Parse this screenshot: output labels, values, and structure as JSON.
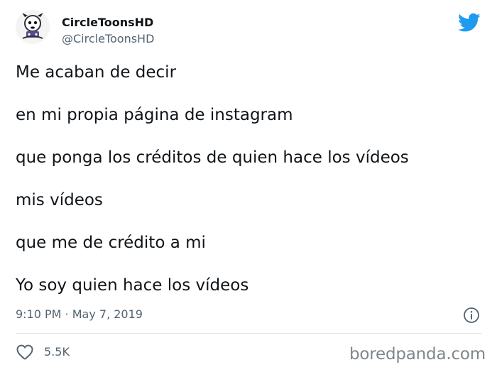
{
  "author": {
    "display_name": "CircleToonsHD",
    "handle": "@CircleToonsHD"
  },
  "tweet": {
    "lines": [
      "Me acaban de decir",
      "en mi propia página de instagram",
      "que ponga los créditos de quien hace los vídeos",
      "mis vídeos",
      "que me de crédito a mi",
      "Yo soy quien hace los vídeos"
    ],
    "timestamp": "9:10 PM · May 7, 2019"
  },
  "engagement": {
    "likes": "5.5K"
  },
  "watermark": "boredpanda.com",
  "icons": {
    "brand": "twitter-bird-icon",
    "info": "info-icon",
    "like": "heart-icon",
    "avatar": "avatar"
  },
  "colors": {
    "twitter_blue": "#1d9bf0",
    "text_primary": "#0f1419",
    "text_secondary": "#536471",
    "divider": "#dfe3e6",
    "watermark": "#7f868b"
  }
}
